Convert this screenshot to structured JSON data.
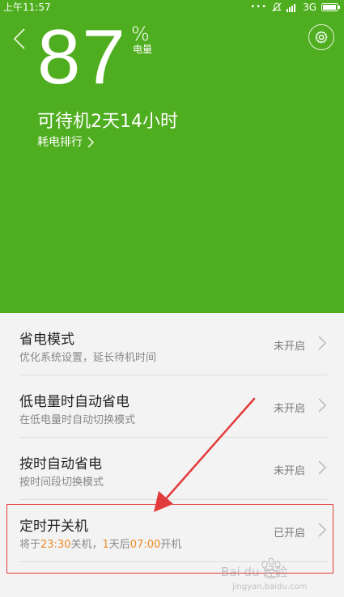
{
  "status_bar": {
    "time": "上午11:57",
    "network": "3G",
    "icons": [
      "ellipsis-icon",
      "mute-icon",
      "signal-icon",
      "battery-icon"
    ]
  },
  "header": {
    "battery_percent": "87",
    "percent_sign": "%",
    "battery_label": "电量",
    "standby_time": "可待机2天14小时",
    "rank_link": "耗电排行",
    "background_color": "#4fae1f"
  },
  "list": {
    "items": [
      {
        "title": "省电模式",
        "subtitle": "优化系统设置，延长待机时间",
        "status": "未开启"
      },
      {
        "title": "低电量时自动省电",
        "subtitle": "在低电量时自动切换模式",
        "status": "未开启"
      },
      {
        "title": "按时自动省电",
        "subtitle": "按时间段切换模式",
        "status": "未开启"
      },
      {
        "title": "定时开关机",
        "subtitle_parts": [
          "将于",
          "23:30",
          "关机，",
          "1",
          "天后",
          "07:00",
          "开机"
        ],
        "status": "已开启"
      }
    ]
  },
  "accent_color": "#f08a24",
  "annotation_color": "#e23b3b",
  "watermark": {
    "text": "Bai du 经验",
    "url": "jingyan.baidu.com"
  }
}
